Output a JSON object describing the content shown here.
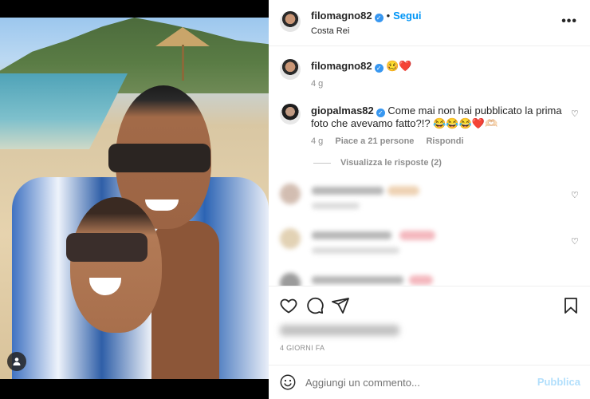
{
  "post": {
    "username": "filomagno82",
    "verified": true,
    "follow_label": "Segui",
    "location": "Costa Rei",
    "more_icon": "more-horizontal-icon"
  },
  "caption": {
    "username": "filomagno82",
    "text": "🥴❤️",
    "time": "4 g"
  },
  "comments": [
    {
      "username": "giopalmas82",
      "verified": true,
      "text": "Come mai non hai pubblicato la prima foto che avevamo fatto?!? 😂😂😂❤️🫶🏻",
      "time": "4 g",
      "likes": "Piace a 21 persone",
      "reply_label": "Rispondi",
      "view_replies": "Visualizza le risposte (2)"
    }
  ],
  "actions": {
    "like_icon": "heart-icon",
    "comment_icon": "comment-icon",
    "share_icon": "send-icon",
    "save_icon": "bookmark-icon"
  },
  "timestamp": "4 GIORNI FA",
  "add_comment": {
    "placeholder": "Aggiungi un commento...",
    "publish_label": "Pubblica"
  },
  "colors": {
    "accent": "#0095f6",
    "publish_disabled": "#b2dffc",
    "muted": "#8e8e8e"
  }
}
